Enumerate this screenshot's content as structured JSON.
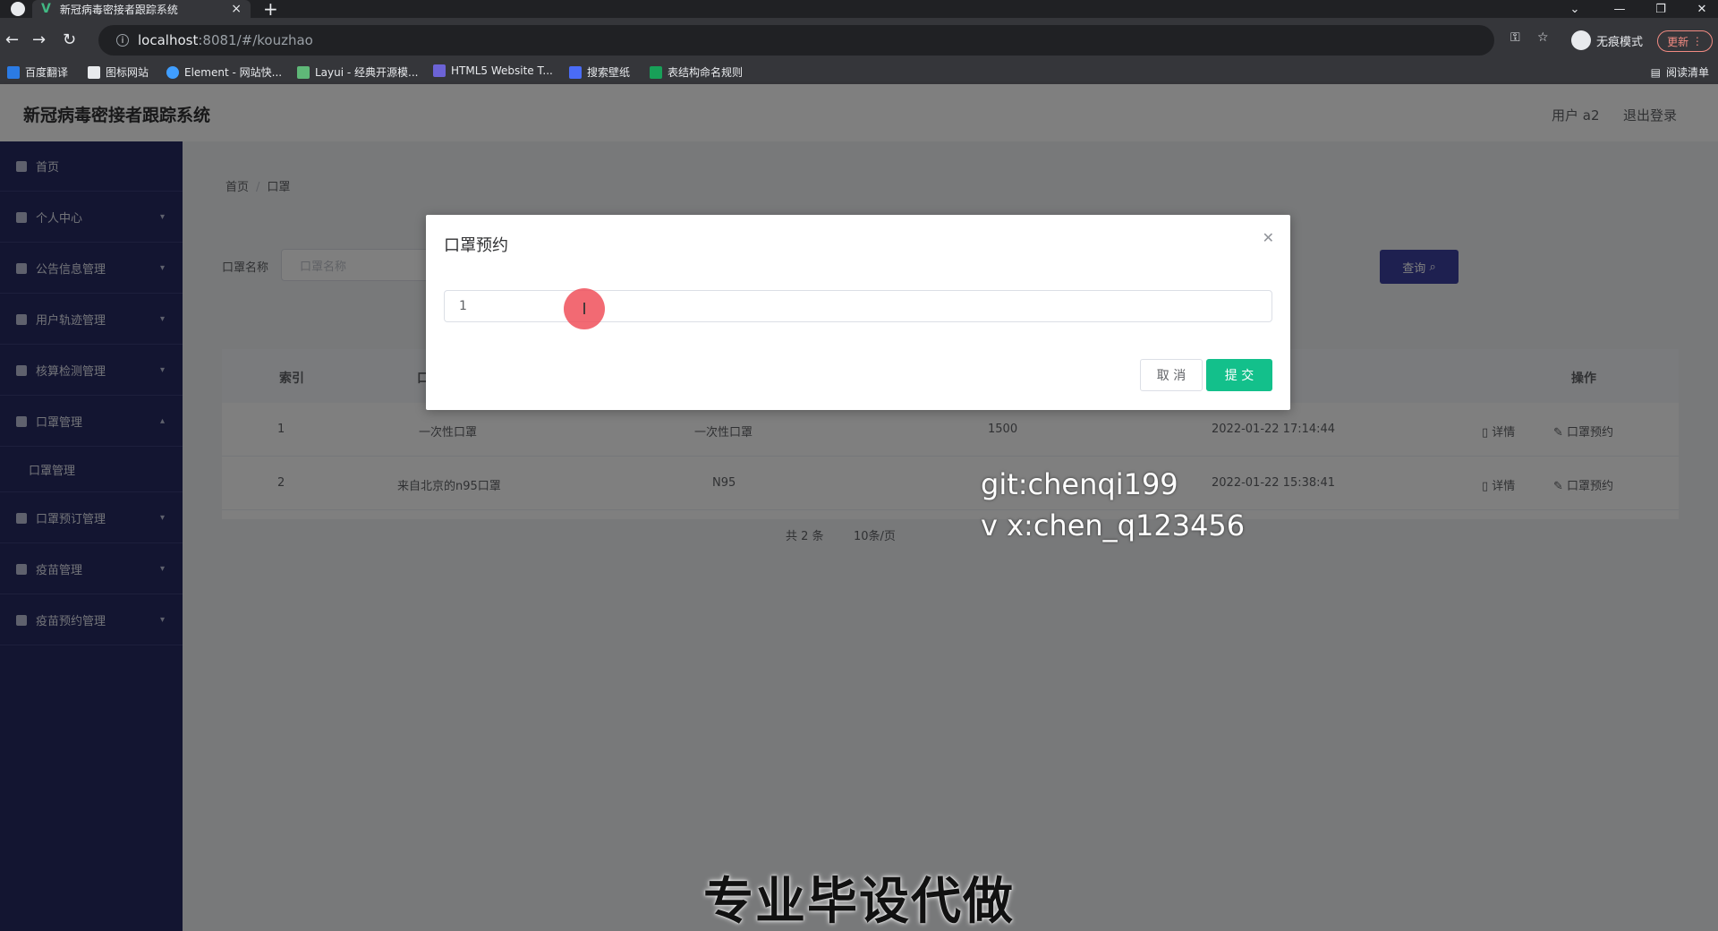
{
  "browser": {
    "tab_title": "新冠病毒密接者跟踪系统",
    "url_host": "localhost",
    "url_path": ":8081/#/kouzhao",
    "incognito_label": "无痕模式",
    "update_label": "更新",
    "reading_list": "阅读清单",
    "bookmarks": [
      "百度翻译",
      "图标网站",
      "Element - 网站快...",
      "Layui - 经典开源模...",
      "HTML5 Website T...",
      "搜索壁纸",
      "表结构命名规则"
    ]
  },
  "app": {
    "title": "新冠病毒密接者跟踪系统",
    "user_label": "用户 a2",
    "logout": "退出登录"
  },
  "sidebar": {
    "items": [
      {
        "label": "首页"
      },
      {
        "label": "个人中心"
      },
      {
        "label": "公告信息管理"
      },
      {
        "label": "用户轨迹管理"
      },
      {
        "label": "核算检测管理"
      },
      {
        "label": "口罩管理"
      },
      {
        "label": "口罩管理"
      },
      {
        "label": "口罩预订管理"
      },
      {
        "label": "疫苗管理"
      },
      {
        "label": "疫苗预约管理"
      }
    ]
  },
  "breadcrumb": {
    "home": "首页",
    "current": "口罩"
  },
  "search": {
    "label": "口罩名称",
    "placeholder": "口罩名称",
    "button": "查询"
  },
  "table": {
    "headers": {
      "index": "索引",
      "name": "口",
      "action": "操作"
    },
    "rows": [
      {
        "index": "1",
        "name": "一次性口罩",
        "type": "一次性口罩",
        "qty": "1500",
        "time": "2022-01-22 17:14:44"
      },
      {
        "index": "2",
        "name": "来自北京的n95口罩",
        "type": "N95",
        "qty": "",
        "time": "2022-01-22 15:38:41"
      }
    ],
    "detail_label": "详情",
    "reserve_label": "口罩预约"
  },
  "pagination": {
    "total": "共 2 条",
    "page_size": "10条/页"
  },
  "dialog": {
    "title": "口罩预约",
    "input_value": "1",
    "cancel": "取 消",
    "submit": "提 交"
  },
  "watermark": {
    "line1": "git:chenqi199",
    "line2": "v x:chen_q123456"
  },
  "caption": "专业毕设代做"
}
